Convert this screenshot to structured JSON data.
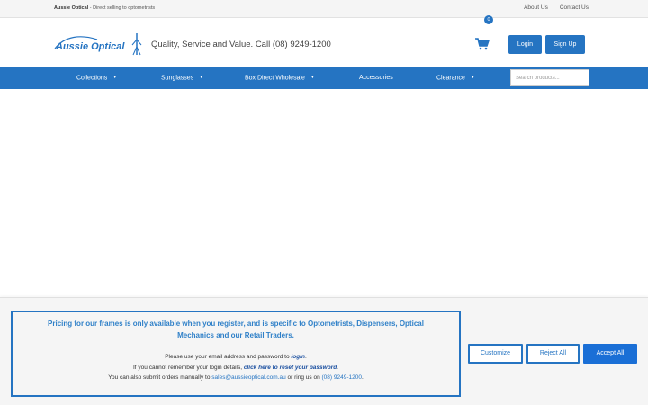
{
  "topbar": {
    "brand": "Aussie Optical",
    "tagline": " - Direct selling to optometrists",
    "links": [
      "About Us",
      "Contact Us"
    ]
  },
  "header": {
    "logo_text": "Aussie Optical",
    "tagline": "Quality, Service and Value. Call (08) 9249-1200",
    "cart_count": "0",
    "login_label": "Login",
    "signup_label": "Sign Up"
  },
  "nav": {
    "items": [
      {
        "label": "Collections",
        "has_dropdown": true
      },
      {
        "label": "Sunglasses",
        "has_dropdown": true
      },
      {
        "label": "Box Direct Wholesale",
        "has_dropdown": true
      },
      {
        "label": "Accessories",
        "has_dropdown": false
      },
      {
        "label": "Clearance",
        "has_dropdown": true
      }
    ],
    "search_placeholder": "Search products...",
    "caret": "▼"
  },
  "cookie": {
    "heading": "Pricing for our frames is only available when you register, and is specific to Optometrists, Dispensers, Optical Mechanics and our Retail Traders.",
    "line1_pre": "Please use your email address and password to ",
    "line1_link": "login",
    "line1_post": ".",
    "line2_pre": "If you cannot remember your login details, ",
    "line2_link": "click here to reset your password",
    "line2_post": ".",
    "line3_pre": "You can also submit orders manually to ",
    "line3_email": "sales@aussieoptical.com.au",
    "line3_mid": " or ring us on ",
    "line3_phone": "(08) 9249-1200",
    "line3_post": ".",
    "customize_label": "Customize",
    "reject_label": "Reject All",
    "accept_label": "Accept All"
  },
  "colors": {
    "primary": "#2574c2",
    "accent_button": "#1a6fd6",
    "heading_text": "#2f80c8"
  }
}
